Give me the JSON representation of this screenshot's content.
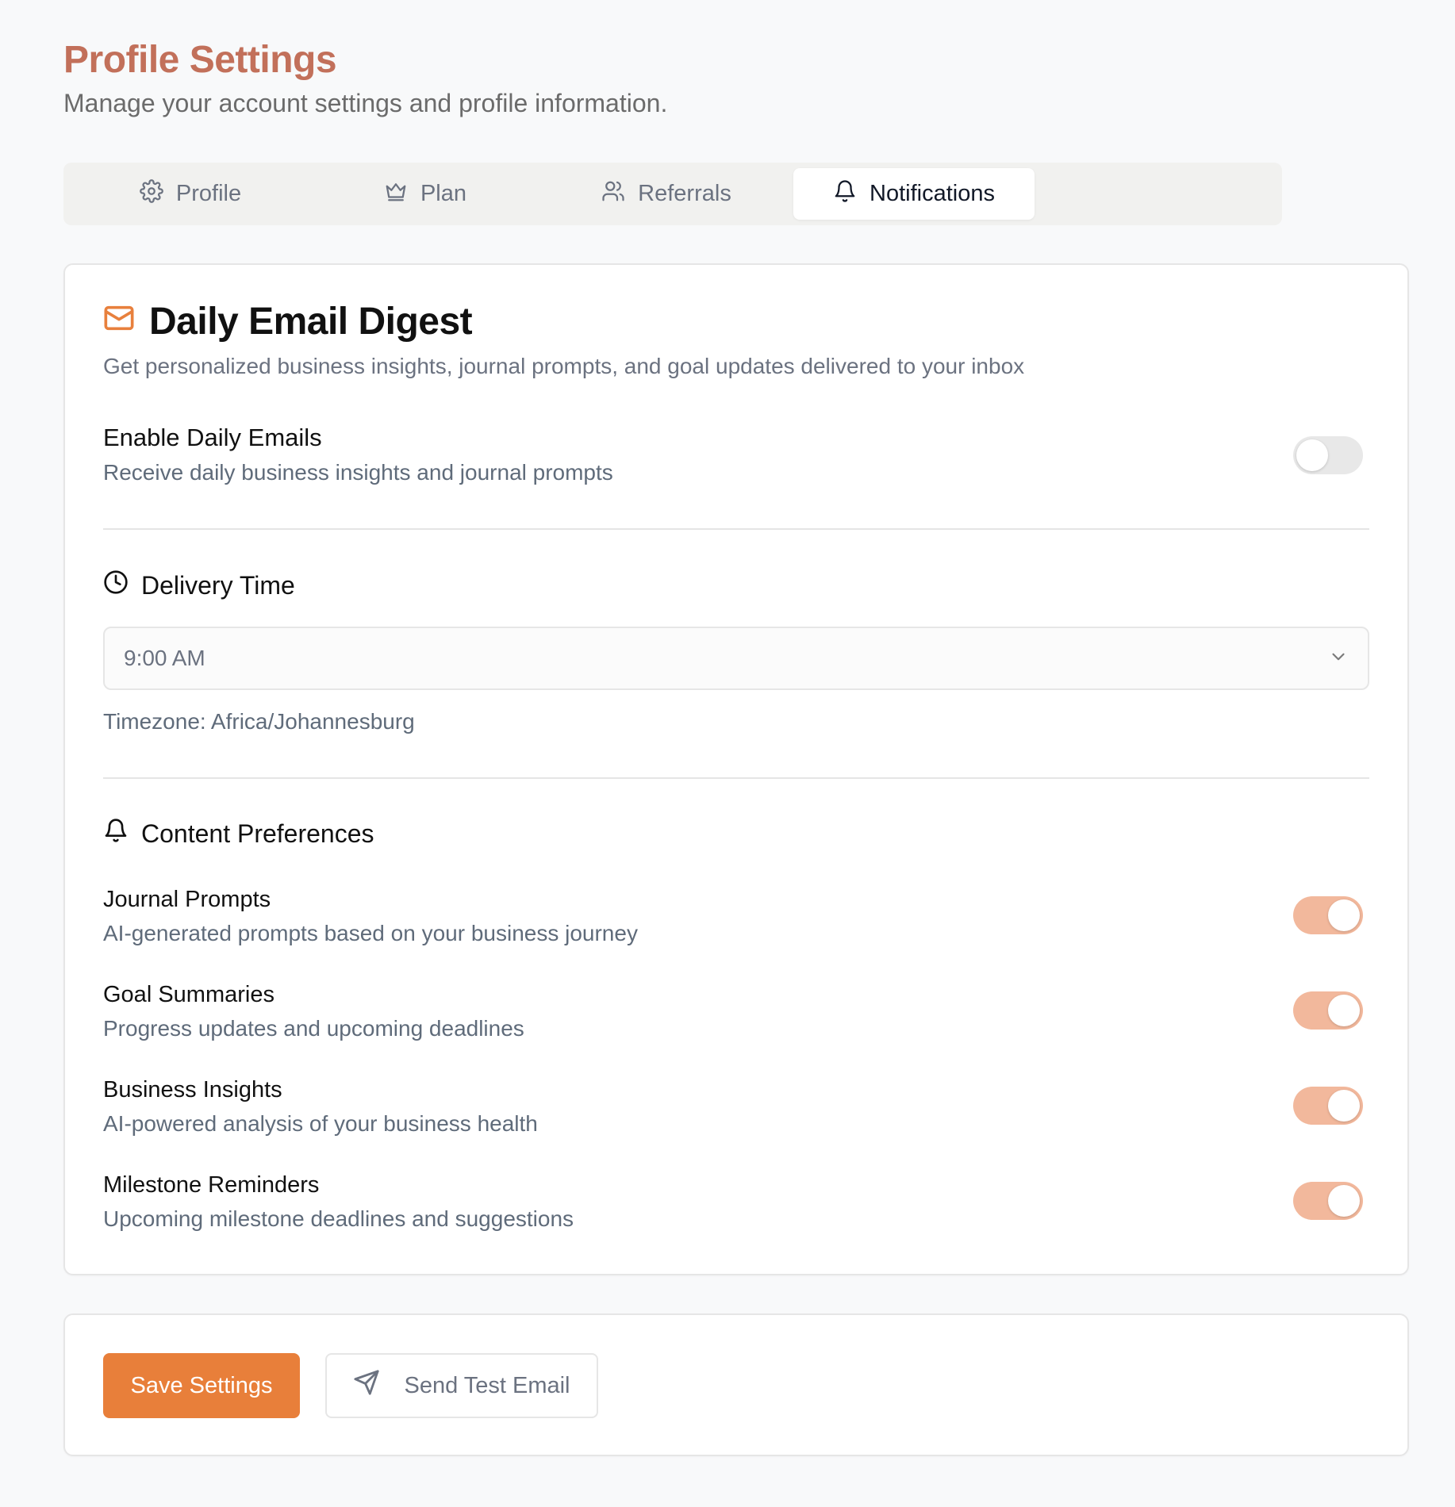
{
  "header": {
    "title": "Profile Settings",
    "subtitle": "Manage your account settings and profile information."
  },
  "tabs": [
    {
      "label": "Profile",
      "icon": "gear-icon",
      "active": false
    },
    {
      "label": "Plan",
      "icon": "crown-icon",
      "active": false
    },
    {
      "label": "Referrals",
      "icon": "users-icon",
      "active": false
    },
    {
      "label": "Notifications",
      "icon": "bell-icon",
      "active": true
    }
  ],
  "digest": {
    "title": "Daily Email Digest",
    "icon": "mail-icon",
    "description": "Get personalized business insights, journal prompts, and goal updates delivered to your inbox",
    "enable": {
      "title": "Enable Daily Emails",
      "subtitle": "Receive daily business insights and journal prompts",
      "enabled": false
    }
  },
  "delivery": {
    "heading": "Delivery Time",
    "icon": "clock-icon",
    "selected_time": "9:00 AM",
    "timezone": "Timezone: Africa/Johannesburg"
  },
  "content": {
    "heading": "Content Preferences",
    "icon": "bell-icon",
    "items": [
      {
        "title": "Journal Prompts",
        "subtitle": "AI-generated prompts based on your business journey",
        "enabled": true
      },
      {
        "title": "Goal Summaries",
        "subtitle": "Progress updates and upcoming deadlines",
        "enabled": true
      },
      {
        "title": "Business Insights",
        "subtitle": "AI-powered analysis of your business health",
        "enabled": true
      },
      {
        "title": "Milestone Reminders",
        "subtitle": "Upcoming milestone deadlines and suggestions",
        "enabled": true
      }
    ]
  },
  "actions": {
    "save_label": "Save Settings",
    "test_label": "Send Test Email"
  },
  "colors": {
    "brand_title": "#c2705a",
    "accent": "#e87f3a",
    "toggle_on": "#f2b89c",
    "toggle_off": "#e8e8e8"
  }
}
